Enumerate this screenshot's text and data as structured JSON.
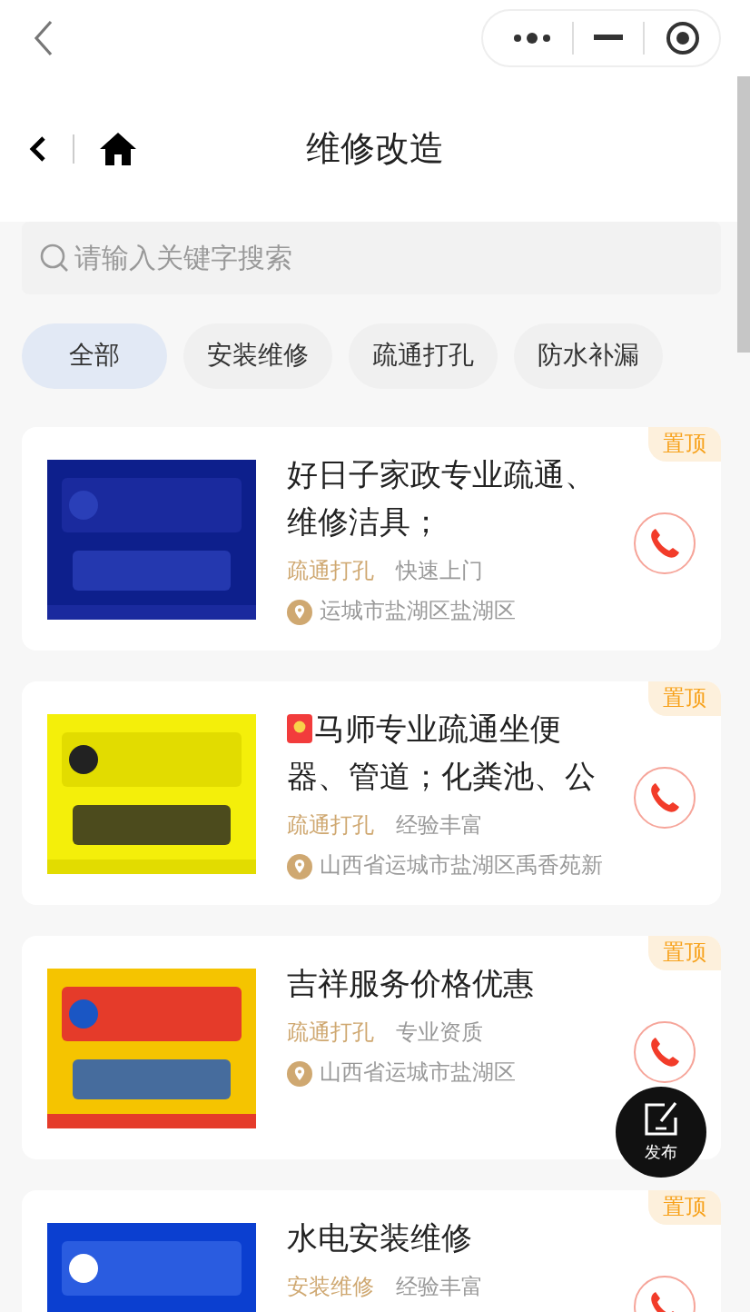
{
  "header": {
    "title": "维修改造"
  },
  "search": {
    "placeholder": "请输入关键字搜索"
  },
  "categories": [
    {
      "label": "全部",
      "selected": true
    },
    {
      "label": "安装维修",
      "selected": false
    },
    {
      "label": "疏通打孔",
      "selected": false
    },
    {
      "label": "防水补漏",
      "selected": false
    }
  ],
  "listings": [
    {
      "title": "好日子家政专业疏通、维修洁具；",
      "red_packet": false,
      "pin_label": "置顶",
      "category": "疏通打孔",
      "feature": "快速上门",
      "address": "运城市盐湖区盐湖区"
    },
    {
      "title": "马师专业疏通坐便器、管道；化粪池、公",
      "red_packet": true,
      "pin_label": "置顶",
      "category": "疏通打孔",
      "feature": "经验丰富",
      "address": "山西省运城市盐湖区禹香苑新"
    },
    {
      "title": "吉祥服务价格优惠",
      "red_packet": false,
      "pin_label": "置顶",
      "category": "疏通打孔",
      "feature": "专业资质",
      "address": "山西省运城市盐湖区"
    },
    {
      "title": "水电安装维修",
      "red_packet": false,
      "pin_label": "置顶",
      "category": "安装维修",
      "feature": "经验丰富"
    }
  ],
  "publish_button": {
    "label": "发布"
  }
}
